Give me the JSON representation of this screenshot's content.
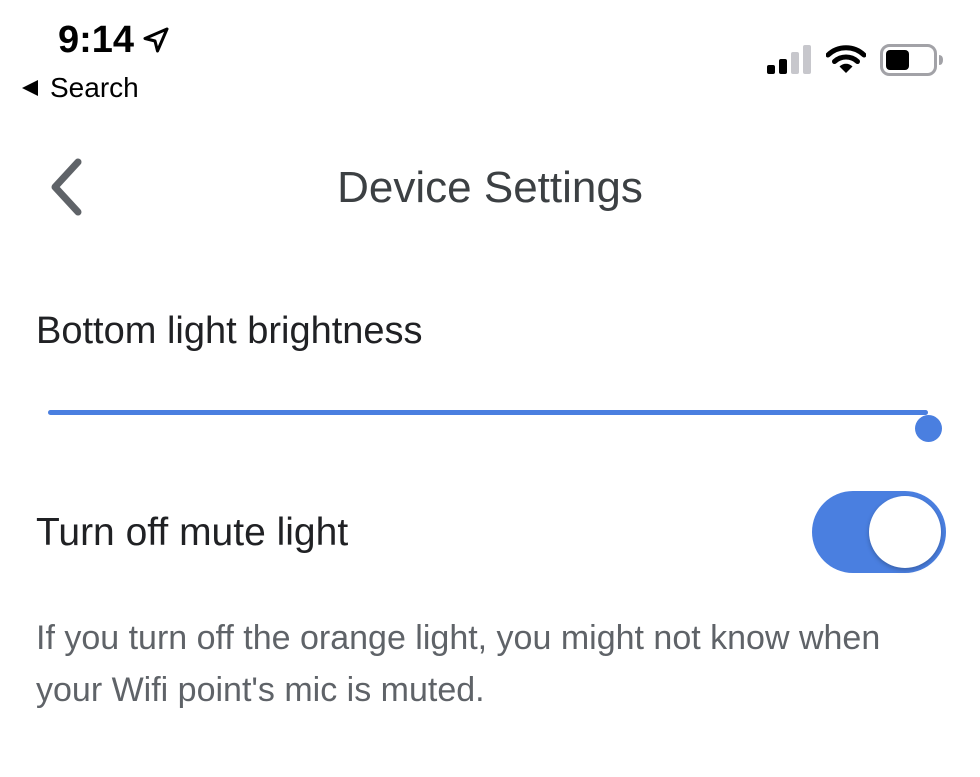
{
  "status_bar": {
    "time": "9:14",
    "location_icon": "location-arrow-icon",
    "back_app_label": "Search",
    "signal_bars_active": 2,
    "signal_bars_total": 4,
    "wifi_icon": "wifi-icon",
    "battery_level": 0.5
  },
  "header": {
    "title": "Device Settings",
    "back_icon": "chevron-left-icon"
  },
  "brightness": {
    "label": "Bottom light brightness",
    "value_fraction": 1.0
  },
  "mute_light": {
    "label": "Turn off mute light",
    "toggle_on": true,
    "description": "If you turn off the orange light, you might not know when your Wifi point's mic is muted."
  },
  "colors": {
    "accent": "#4a7fe0",
    "title_text": "#3c4043",
    "body_text": "#202124",
    "secondary_text": "#5f6368"
  }
}
